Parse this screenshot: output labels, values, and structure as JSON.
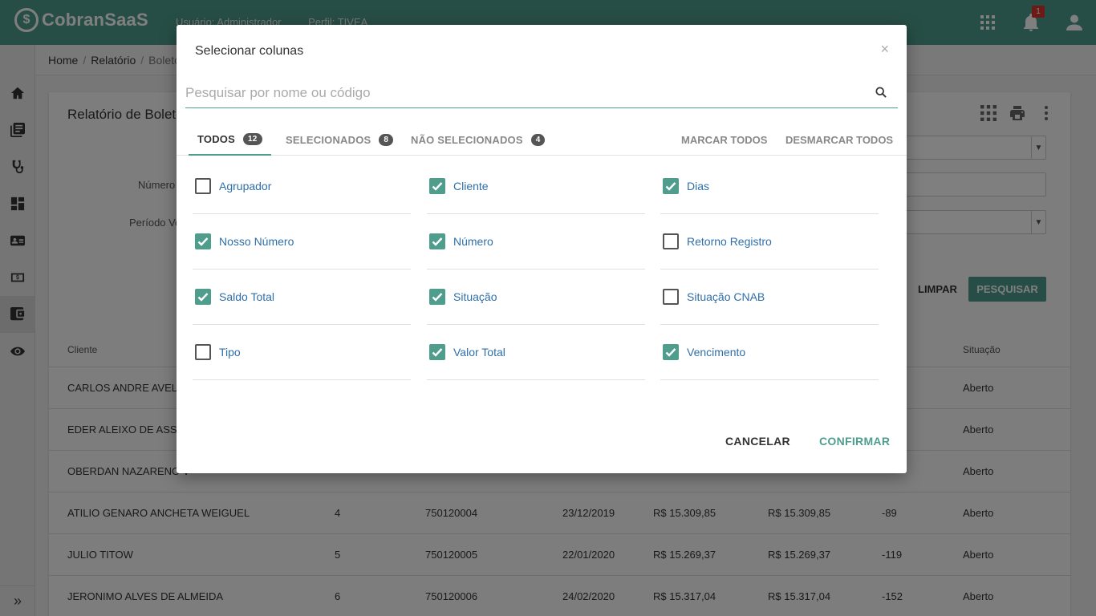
{
  "header": {
    "logo_mark": "$",
    "logo_text": "CobranSaaS",
    "user_label": "Usuário: Administrador",
    "profile_label": "Perfil: TIVEA",
    "notification_count": "1",
    "color": "#4f9d8d"
  },
  "sidebar": {
    "items": [
      "home-icon",
      "report-list-icon",
      "stethoscope-icon",
      "dashboard-icon",
      "contact-card-icon",
      "money-icon",
      "wallet-icon",
      "eye-icon"
    ],
    "expand": "»"
  },
  "breadcrumb": {
    "items": [
      "Home",
      "Relatório",
      "Boletos"
    ],
    "separator": "/"
  },
  "card": {
    "title": "Relatório de Boletos",
    "numero_label": "Número",
    "periodo_label": "Período Ve",
    "limpar": "LIMPAR",
    "pesquisar": "PESQUISAR"
  },
  "table": {
    "columns": [
      "Cliente",
      "Situação"
    ],
    "rows": [
      {
        "cliente": "CARLOS ANDRE AVELIN",
        "numero": "",
        "nosso": "",
        "venc": "",
        "saldo": "",
        "valor": "",
        "dias": "",
        "situacao": "Aberto"
      },
      {
        "cliente": "EDER ALEIXO DE ASSIS",
        "numero": "",
        "nosso": "",
        "venc": "",
        "saldo": "",
        "valor": "",
        "dias": "",
        "situacao": "Aberto"
      },
      {
        "cliente": "OBERDAN NAZARENO V",
        "numero": "",
        "nosso": "",
        "venc": "",
        "saldo": "",
        "valor": "",
        "dias": "",
        "situacao": "Aberto"
      },
      {
        "cliente": "ATILIO GENARO ANCHETA WEIGUEL",
        "numero": "4",
        "nosso": "750120004",
        "venc": "23/12/2019",
        "saldo": "R$ 15.309,85",
        "valor": "R$ 15.309,85",
        "dias": "-89",
        "situacao": "Aberto"
      },
      {
        "cliente": "JULIO TITOW",
        "numero": "5",
        "nosso": "750120005",
        "venc": "22/01/2020",
        "saldo": "R$ 15.269,37",
        "valor": "R$ 15.269,37",
        "dias": "-119",
        "situacao": "Aberto"
      },
      {
        "cliente": "JERONIMO ALVES DE ALMEIDA",
        "numero": "6",
        "nosso": "750120006",
        "venc": "24/02/2020",
        "saldo": "R$ 15.317,04",
        "valor": "R$ 15.317,04",
        "dias": "-152",
        "situacao": "Aberto"
      }
    ]
  },
  "modal": {
    "title": "Selecionar colunas",
    "close": "×",
    "search_placeholder": "Pesquisar por nome ou código",
    "search_value": "",
    "tabs": [
      {
        "label": "TODOS",
        "count": "12",
        "active": true
      },
      {
        "label": "SELECIONADOS",
        "count": "8",
        "active": false
      },
      {
        "label": "NÃO SELECIONADOS",
        "count": "4",
        "active": false
      }
    ],
    "marcar_todos": "MARCAR TODOS",
    "desmarcar_todos": "DESMARCAR TODOS",
    "options": [
      {
        "label": "Agrupador",
        "checked": false
      },
      {
        "label": "Cliente",
        "checked": true
      },
      {
        "label": "Dias",
        "checked": true
      },
      {
        "label": "Nosso Número",
        "checked": true
      },
      {
        "label": "Número",
        "checked": true
      },
      {
        "label": "Retorno Registro",
        "checked": false
      },
      {
        "label": "Saldo Total",
        "checked": true
      },
      {
        "label": "Situação",
        "checked": true
      },
      {
        "label": "Situação CNAB",
        "checked": false
      },
      {
        "label": "Tipo",
        "checked": false
      },
      {
        "label": "Valor Total",
        "checked": true
      },
      {
        "label": "Vencimento",
        "checked": true
      }
    ],
    "cancel": "CANCELAR",
    "confirm": "CONFIRMAR"
  }
}
